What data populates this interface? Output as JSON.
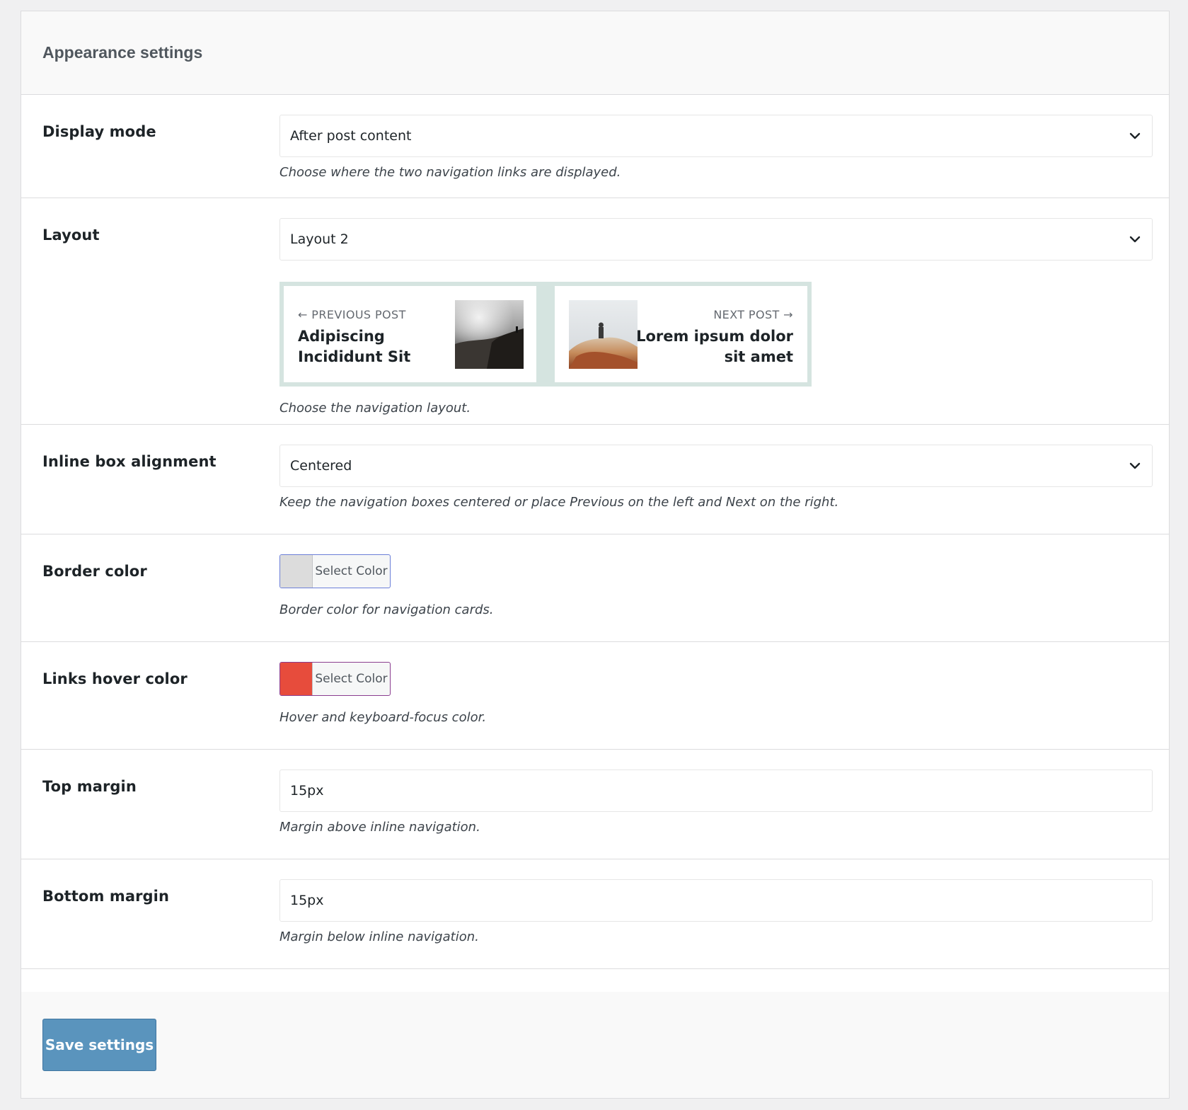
{
  "panel": {
    "title": "Appearance settings"
  },
  "settings": {
    "display_mode": {
      "label": "Display mode",
      "value": "After post content",
      "description": "Choose where the two navigation links are displayed."
    },
    "layout": {
      "label": "Layout",
      "value": "Layout 2",
      "description": "Choose the navigation layout.",
      "preview": {
        "previous": {
          "kicker": "← PREVIOUS POST",
          "title_line1": "Adipiscing",
          "title_line2": "Incididunt Sit"
        },
        "next": {
          "kicker": "NEXT POST →",
          "title_line1": "Lorem ipsum dolor",
          "title_line2": "sit amet"
        },
        "frame_color": "#d5e4e0"
      }
    },
    "inline_box_alignment": {
      "label": "Inline box alignment",
      "value": "Centered",
      "description": "Keep the navigation boxes centered or place Previous on the left and Next on the right."
    },
    "border_color": {
      "label": "Border color",
      "button_label": "Select Color",
      "swatch": "#dcdcdc",
      "description": "Border color for navigation cards."
    },
    "links_hover_color": {
      "label": "Links hover color",
      "button_label": "Select Color",
      "swatch": "#e74c3c",
      "description": "Hover and keyboard-focus color."
    },
    "top_margin": {
      "label": "Top margin",
      "value": "15px",
      "description": "Margin above inline navigation."
    },
    "bottom_margin": {
      "label": "Bottom margin",
      "value": "15px",
      "description": "Margin below inline navigation."
    }
  },
  "footer": {
    "save_label": "Save settings"
  },
  "colors": {
    "accent_button": "#5a94bd",
    "header_bg": "#f9f9f9"
  }
}
